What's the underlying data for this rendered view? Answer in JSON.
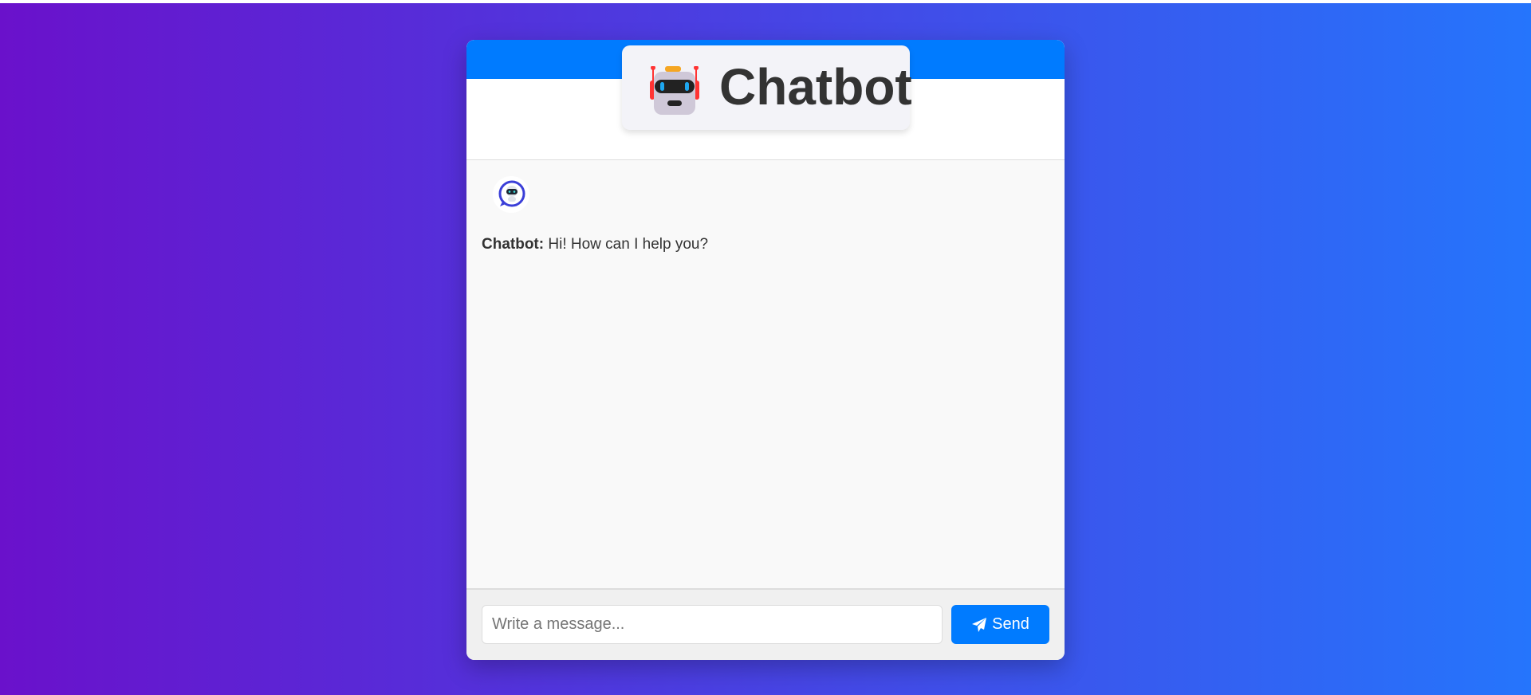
{
  "header": {
    "title": "Chatbot",
    "logo_icon": "robot-icon"
  },
  "messages": [
    {
      "sender": "Chatbot:",
      "text": " Hi! How can I help you?",
      "avatar_icon": "chatbot-avatar-icon"
    }
  ],
  "composer": {
    "placeholder": "Write a message...",
    "value": "",
    "send_label": "Send",
    "send_icon": "paper-plane-icon"
  },
  "colors": {
    "accent": "#007bff",
    "gradient_start": "#6a11cb",
    "gradient_end": "#2575fc"
  }
}
